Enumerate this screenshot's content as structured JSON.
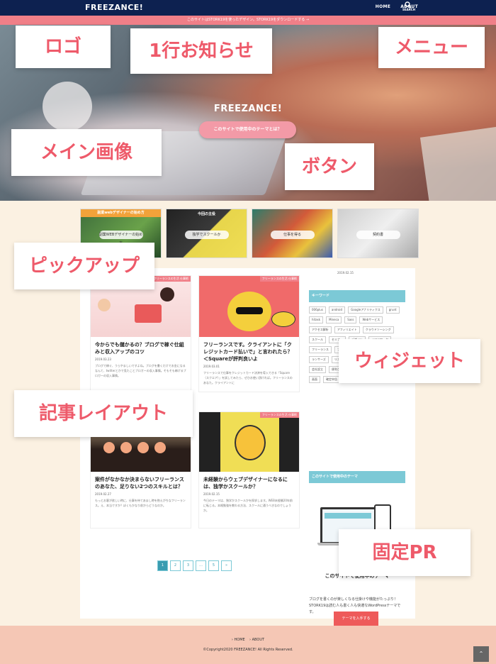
{
  "header": {
    "logo": "FREEZANCE!",
    "nav": [
      "HOME",
      "ABOUT"
    ],
    "search_label": "SEARCH"
  },
  "notice": "このサイトはSTORK19を使ったデザイン。STORK19をダウンロードする →",
  "hero": {
    "title": "FREEZANCE!",
    "button": "このサイトで使用中のテーマとは？"
  },
  "pickups": [
    {
      "caption": "副業webデザイナーの始め方",
      "label": "副業WEBデザイナーの始め方"
    },
    {
      "caption": "今回の主役",
      "label": "独学でスクールか"
    },
    {
      "caption": "",
      "label": "仕事を得る"
    },
    {
      "caption": "",
      "label": "契約書"
    }
  ],
  "articles": [
    {
      "tag": "フリーランスの生活 仕事術",
      "title": "今からでも儲かるの？ブログで稼ぐ仕組みと収入アップのコツ",
      "date": "2019.03.23",
      "excerpt": "ブログで稼ぐ、うらやましいですよね。ブログを書くだけでお金になるなんて、twitterとかで見たことブロガーの収入事情。そもそも稼げるブロガーの収入事情。"
    },
    {
      "tag": "フリーランスの生活 仕事術",
      "title": "フリーランスです。クライアントに「クレジットカード払いで」と言われたら？＜Squareが評判良いよ",
      "date": "2019.03.01",
      "excerpt": "フリーランスで仕事をクレジットカード決済を導入できる「Square（スクエア）」を試してみたら、ぜひお使い頂ければ。フリーランスのあなた。クライアントに"
    },
    {
      "tag": "フリーランスの生活 仕事術",
      "title": "案件がなかなか決まらないフリーランスのあなた、足りない2つのスキルとは？",
      "date": "2019.02.27",
      "excerpt": "もっとお客が欲しい時に、仕事を待てあまし時を抱えがちなフリーランス。え、本当ですか？ぼくもかなり前からどうなのか。"
    },
    {
      "tag": "フリーランスの生活 仕事術",
      "title": "未経験からウェブデザイナーになるには、独学かスクールか？",
      "date": "2019.02.15",
      "excerpt": "今日のテーマは、独学かスクールかを探求します。WEB未経験20年前に転じる。本格勉強を教わる方法、スクールに通うべきなのでしょうか。"
    }
  ],
  "sidebar": {
    "recent_date": "2019.02.15",
    "keyword_title": "キーワード",
    "tags": [
      "006plus",
      "android",
      "Googleアナリティクス",
      "grunt",
      "hitask",
      "Mineca",
      "Sass",
      "Webサービス",
      "アクセス解析",
      "アフィリエイト",
      "クラウドソーシング",
      "スクール",
      "セミナー",
      "デザイン",
      "ノマドワーク",
      "フリーランス",
      "プログラミング",
      "ベクター",
      "マウス",
      "ランサーズ",
      "リスティング広告",
      "ロゴ",
      "入門",
      "大学生",
      "会社設立",
      "便利グッズ",
      "副業",
      "動画",
      "写真素材",
      "画面",
      "確定申告",
      "時給",
      "単価",
      "読み書"
    ],
    "pr_title": "このサイトで使用中のテーマ",
    "pr_heading": "このサイトで使用中のテーマ",
    "pr_text": "ブログを書くのが楽しくなる仕掛けや機能がたっぷり！STORK19は読む人も書く人も快適なWordPressテーマです。",
    "pr_button": "テーマを入手する"
  },
  "pagination": [
    "1",
    "2",
    "3",
    "…",
    "5",
    "»"
  ],
  "footer": {
    "links": [
      "HOME",
      "ABOUT"
    ],
    "copyright": "©Copyright2020 FREEZANCE! All Rights Reserved."
  },
  "annotations": [
    "ロゴ",
    "1行お知らせ",
    "メニュー",
    "メイン画像",
    "ボタン",
    "ピックアップ",
    "ウィジェット",
    "記事レイアウト",
    "固定PR"
  ],
  "colors": {
    "accent": "#ee5a6a",
    "header": "#0d2150",
    "notice": "#f07f88",
    "widget": "#7cc9d6"
  }
}
